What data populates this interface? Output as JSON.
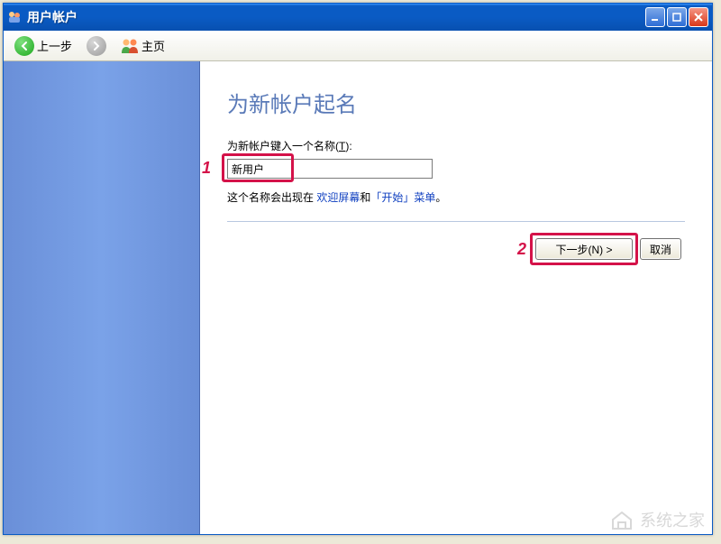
{
  "window": {
    "title": "用户帐户"
  },
  "toolbar": {
    "back_label": "上一步",
    "home_label": "主页"
  },
  "page": {
    "heading": "为新帐户起名",
    "field_label_prefix": "为新帐户键入一个名称(",
    "field_label_key": "T",
    "field_label_suffix": "):",
    "input_value": "新用户",
    "desc_prefix": "这个名称会出现在 ",
    "desc_link1": "欢迎屏幕",
    "desc_mid": "和",
    "desc_link2": "「开始」菜单",
    "desc_suffix": "。"
  },
  "buttons": {
    "next": "下一步(N) >",
    "cancel": "取消"
  },
  "markers": {
    "m1": "1",
    "m2": "2"
  },
  "watermark": {
    "text": "系统之家"
  }
}
